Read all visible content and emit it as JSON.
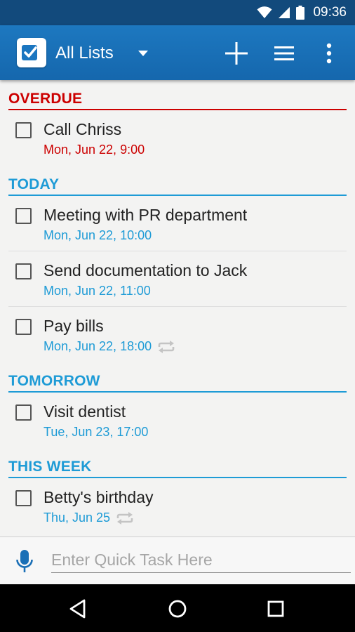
{
  "status_bar": {
    "time": "09:36",
    "icons": [
      "wifi-icon",
      "cell-signal-icon",
      "battery-icon"
    ]
  },
  "app_bar": {
    "title": "All Lists",
    "icons": [
      "app-logo-icon",
      "dropdown-arrow-icon",
      "add-icon",
      "list-view-icon",
      "overflow-menu-icon"
    ]
  },
  "colors": {
    "accent": "#1e9bd6",
    "overdue": "#cc0000",
    "app_bar": "#1a6fb6",
    "status_bar": "#124a7c"
  },
  "sections": [
    {
      "title": "OVERDUE",
      "tasks": [
        {
          "title": "Call Chriss",
          "date": "Mon, Jun 22, 9:00",
          "repeat": false
        }
      ]
    },
    {
      "title": "TODAY",
      "tasks": [
        {
          "title": "Meeting with PR department",
          "date": "Mon, Jun 22, 10:00",
          "repeat": false
        },
        {
          "title": "Send documentation to Jack",
          "date": "Mon, Jun 22, 11:00",
          "repeat": false
        },
        {
          "title": "Pay bills",
          "date": "Mon, Jun 22, 18:00",
          "repeat": true
        }
      ]
    },
    {
      "title": "TOMORROW",
      "tasks": [
        {
          "title": "Visit dentist",
          "date": "Tue, Jun 23, 17:00",
          "repeat": false
        }
      ]
    },
    {
      "title": "THIS WEEK",
      "tasks": [
        {
          "title": "Betty's birthday",
          "date": "Thu, Jun 25",
          "repeat": true
        }
      ]
    }
  ],
  "quick_task": {
    "placeholder": "Enter Quick Task Here",
    "value": ""
  },
  "nav_bar": {
    "icons": [
      "back-icon",
      "home-icon",
      "recents-icon"
    ]
  }
}
